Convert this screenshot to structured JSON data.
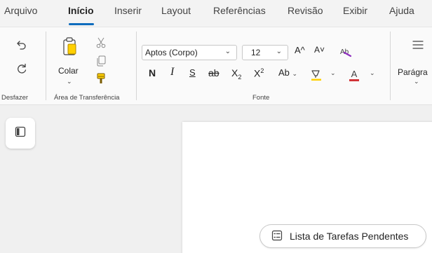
{
  "tabs": [
    {
      "label": "Arquivo",
      "active": false
    },
    {
      "label": "Início",
      "active": true
    },
    {
      "label": "Inserir",
      "active": false
    },
    {
      "label": "Layout",
      "active": false
    },
    {
      "label": "Referências",
      "active": false
    },
    {
      "label": "Revisão",
      "active": false
    },
    {
      "label": "Exibir",
      "active": false
    },
    {
      "label": "Ajuda",
      "active": false
    }
  ],
  "ribbon": {
    "undo": {
      "undo_icon": "undo-icon",
      "redo_icon": "redo-icon",
      "group_label": "Desfazer"
    },
    "clipboard": {
      "paste_label": "Colar",
      "paste_icon": "clipboard-paste-icon",
      "cut_icon": "scissors-icon",
      "copy_icon": "copy-icon",
      "format_painter_icon": "format-painter-icon",
      "group_label": "Área de Transferência"
    },
    "font": {
      "font_name": "Aptos (Corpo)",
      "font_size": "12",
      "grow_label": "A^",
      "shrink_label": "A˅",
      "bold": "N",
      "italic": "I",
      "underline": "S",
      "strike": "ab",
      "subscript_base": "X",
      "subscript_mark": "2",
      "superscript_base": "X",
      "superscript_mark": "2",
      "case_label": "Ab",
      "highlight_icon": "highlighter-icon",
      "font_color_label": "A",
      "group_label": "Fonte"
    },
    "paragraph": {
      "label": "Parágra",
      "icon": "paragraph-align-icon"
    }
  },
  "workspace": {
    "nav_icon": "navigation-pane-icon",
    "task_button": "Lista de Tarefas Pendentes"
  },
  "colors": {
    "accent": "#0f6cbd",
    "highlight_yellow": "#ffd000",
    "font_color_red": "#d13438",
    "clear_format_purple": "#8f2fbf"
  }
}
